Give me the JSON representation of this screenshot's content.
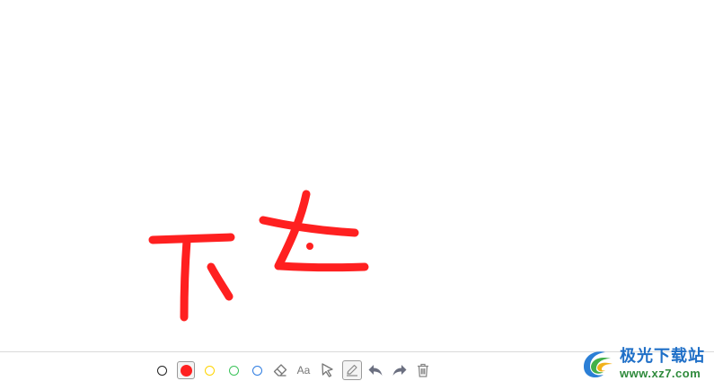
{
  "palette": {
    "black": "#222222",
    "red": "#ff2020",
    "yellow": "#ffd400",
    "green": "#3cc35a",
    "blue": "#2f7de1"
  },
  "stroke_color": "#ff2020",
  "toolbar": {
    "colors": [
      "black",
      "red",
      "yellow",
      "green",
      "blue"
    ],
    "selected_color": "red",
    "eraser_icon": "eraser-icon",
    "text_tool_label": "Aa",
    "select_icon": "pointer-icon",
    "pen_icon": "pen-icon",
    "pen_selected": true,
    "undo_icon": "undo-icon",
    "redo_icon": "redo-icon",
    "delete_icon": "trash-icon"
  },
  "watermark": {
    "title": "极光下载站",
    "url": "www.xz7.com"
  }
}
